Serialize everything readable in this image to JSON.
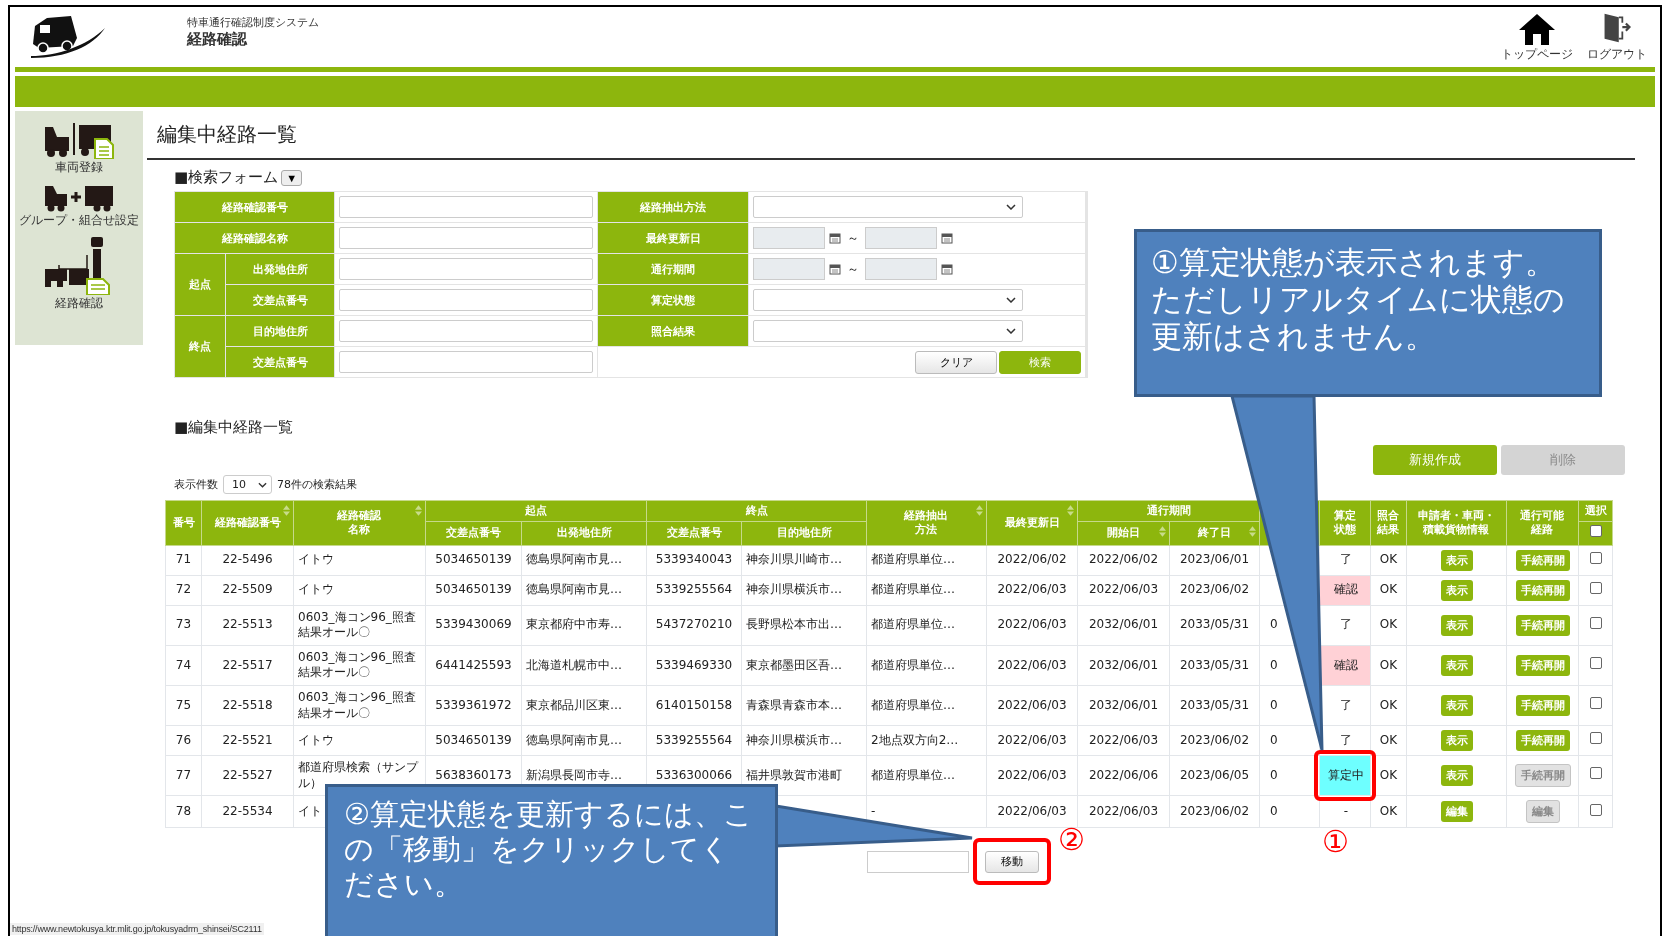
{
  "header": {
    "subtitle": "特車通行確認制度システム",
    "title": "経路確認",
    "nav": [
      {
        "label": "トップページ",
        "kind": "home"
      },
      {
        "label": "ログアウト",
        "kind": "logout"
      }
    ]
  },
  "sidebar": {
    "items": [
      {
        "label": "車両登録",
        "kind": "vehicle"
      },
      {
        "label": "グループ・組合せ設定",
        "kind": "group"
      },
      {
        "label": "経路確認",
        "kind": "route"
      }
    ]
  },
  "page_title": "編集中経路一覧",
  "search_form": {
    "title": "■検索フォーム",
    "toggle": "▼",
    "left": [
      {
        "label": "経路確認番号"
      },
      {
        "label": "経路確認名称"
      },
      {
        "group": "起点",
        "children": [
          {
            "label": "出発地住所"
          },
          {
            "label": "交差点番号"
          }
        ]
      },
      {
        "group": "終点",
        "children": [
          {
            "label": "目的地住所"
          },
          {
            "label": "交差点番号"
          }
        ]
      }
    ],
    "right": [
      {
        "label": "経路抽出方法",
        "kind": "select"
      },
      {
        "label": "最終更新日",
        "kind": "date_range",
        "separator": "～"
      },
      {
        "label": "通行期間",
        "kind": "date_range",
        "separator": "～"
      },
      {
        "label": "算定状態",
        "kind": "select"
      },
      {
        "label": "照合結果",
        "kind": "select"
      }
    ],
    "buttons": [
      {
        "label": "クリア",
        "kind": "secondary"
      },
      {
        "label": "検索",
        "kind": "primary"
      }
    ]
  },
  "list": {
    "title": "■編集中経路一覧",
    "actions": [
      {
        "label": "新規作成",
        "disabled": false
      },
      {
        "label": "削除",
        "disabled": true
      }
    ],
    "page_size_label": "表示件数",
    "page_size": "10",
    "result_count": "78件の検索結果",
    "columns": [
      {
        "label": "番号"
      },
      {
        "label": "経路確認番号",
        "sortable": true
      },
      {
        "label": "経路確認名称",
        "sortable": true
      },
      {
        "label": "起点",
        "children": [
          {
            "label": "交差点番号"
          },
          {
            "label": "出発地住所"
          }
        ]
      },
      {
        "label": "終点",
        "children": [
          {
            "label": "交差点番号"
          },
          {
            "label": "目的地住所"
          }
        ]
      },
      {
        "label": "経路抽出方法",
        "sortable": true
      },
      {
        "label": "最終更新日",
        "sortable": true
      },
      {
        "label": "通行期間",
        "children": [
          {
            "label": "開始日",
            "sortable": true
          },
          {
            "label": "終了日",
            "sortable": true
          }
        ]
      },
      {},
      {
        "label": "算定状態"
      },
      {
        "label": "照合結果"
      },
      {
        "label": "申請者・車両・積載貨物情報"
      },
      {
        "label": "通行可能経路"
      },
      {
        "label": "選択",
        "kind": "checkbox",
        "checked": false
      }
    ],
    "rows": [
      {
        "no": "71",
        "route_no": "22-5496",
        "name": "イトウ",
        "start_node": "5034650139",
        "start_addr": "徳島県阿南市見…",
        "end_node": "5339340043",
        "end_addr": "神奈川県川崎市…",
        "method": "都道府県単位…",
        "updated": "2022/06/02",
        "from": "2022/06/02",
        "to": "2023/06/01",
        "status": {
          "text": "了"
        },
        "match": "OK",
        "info_button": "表示",
        "route_button": {
          "label": "手続再開",
          "disabled": false
        },
        "checked": false
      },
      {
        "no": "72",
        "route_no": "22-5509",
        "name": "イトウ",
        "start_node": "5034650139",
        "start_addr": "徳島県阿南市見…",
        "end_node": "5339255564",
        "end_addr": "神奈川県横浜市…",
        "method": "都道府県単位…",
        "updated": "2022/06/03",
        "from": "2022/06/03",
        "to": "2023/06/02",
        "status": {
          "text": "確認",
          "color": "#ffd1d6"
        },
        "match": "OK",
        "info_button": "表示",
        "route_button": {
          "label": "手続再開",
          "disabled": false
        },
        "checked": false
      },
      {
        "no": "73",
        "route_no": "22-5513",
        "name": "0603_海コン96_照査結果オール〇",
        "start_node": "5339430069",
        "start_addr": "東京都府中市寿…",
        "end_node": "5437270210",
        "end_addr": "長野県松本市出…",
        "method": "都道府県単位…",
        "updated": "2022/06/03",
        "from": "2032/06/01",
        "to": "2033/05/31",
        "column_12": "0",
        "status": {
          "text": "了"
        },
        "match": "OK",
        "info_button": "表示",
        "route_button": {
          "label": "手続再開",
          "disabled": false
        },
        "checked": false
      },
      {
        "no": "74",
        "route_no": "22-5517",
        "name": "0603_海コン96_照査結果オール〇",
        "start_node": "6441425593",
        "start_addr": "北海道札幌市中…",
        "end_node": "5339469330",
        "end_addr": "東京都墨田区吾…",
        "method": "都道府県単位…",
        "updated": "2022/06/03",
        "from": "2032/06/01",
        "to": "2033/05/31",
        "column_12": "0",
        "status": {
          "text": "確認",
          "color": "#ffd1d6"
        },
        "match": "OK",
        "info_button": "表示",
        "route_button": {
          "label": "手続再開",
          "disabled": false
        },
        "checked": false
      },
      {
        "no": "75",
        "route_no": "22-5518",
        "name": "0603_海コン96_照査結果オール〇",
        "start_node": "5339361972",
        "start_addr": "東京都品川区東…",
        "end_node": "6140150158",
        "end_addr": "青森県青森市本…",
        "method": "都道府県単位…",
        "updated": "2022/06/03",
        "from": "2032/06/01",
        "to": "2033/05/31",
        "column_12": "0",
        "status": {
          "text": "了"
        },
        "match": "OK",
        "info_button": "表示",
        "route_button": {
          "label": "手続再開",
          "disabled": false
        },
        "checked": false
      },
      {
        "no": "76",
        "route_no": "22-5521",
        "name": "イトウ",
        "start_node": "5034650139",
        "start_addr": "徳島県阿南市見…",
        "end_node": "5339255564",
        "end_addr": "神奈川県横浜市…",
        "method": "2地点双方向2…",
        "updated": "2022/06/03",
        "from": "2022/06/03",
        "to": "2023/06/02",
        "column_12": "0",
        "status": {
          "text": "了"
        },
        "match": "OK",
        "info_button": "表示",
        "route_button": {
          "label": "手続再開",
          "disabled": false
        },
        "checked": false
      },
      {
        "no": "77",
        "route_no": "22-5527",
        "name": "都道府県検索（サンプル）",
        "start_node": "5638360173",
        "start_addr": "新潟県長岡市寺…",
        "end_node": "5336300066",
        "end_addr": "福井県敦賀市港町",
        "method": "都道府県単位…",
        "updated": "2022/06/03",
        "from": "2022/06/06",
        "to": "2023/06/05",
        "column_12": "0",
        "status": {
          "text": "算定中",
          "color": "#6effff",
          "highlighted": true
        },
        "match": "OK",
        "info_button": "表示",
        "route_button": {
          "label": "手続再開",
          "disabled": true
        },
        "checked": false
      },
      {
        "no": "78",
        "route_no": "22-5534",
        "name": "イト",
        "method": "-",
        "updated": "2022/06/03",
        "from": "2022/06/03",
        "to": "2023/06/02",
        "column_12": "0",
        "status": {
          "text": "-"
        },
        "match": "OK",
        "info_button": "編集",
        "route_button": {
          "label": "編集",
          "disabled": true
        },
        "checked": false
      }
    ],
    "pager": {
      "button": "移動",
      "highlighted": true
    }
  },
  "status_url": "https://www.newtokusya.ktr.mlit.go.jp/tokusyadrm_shinsei/SC2111",
  "callouts": [
    {
      "text": "①算定状態が表示されます。ただしリアルタイムに状態の更新はされません。"
    },
    {
      "text": "②算定状態を更新するには、この「移動」をクリックしてください。"
    }
  ],
  "markers": [
    "②",
    "①"
  ]
}
